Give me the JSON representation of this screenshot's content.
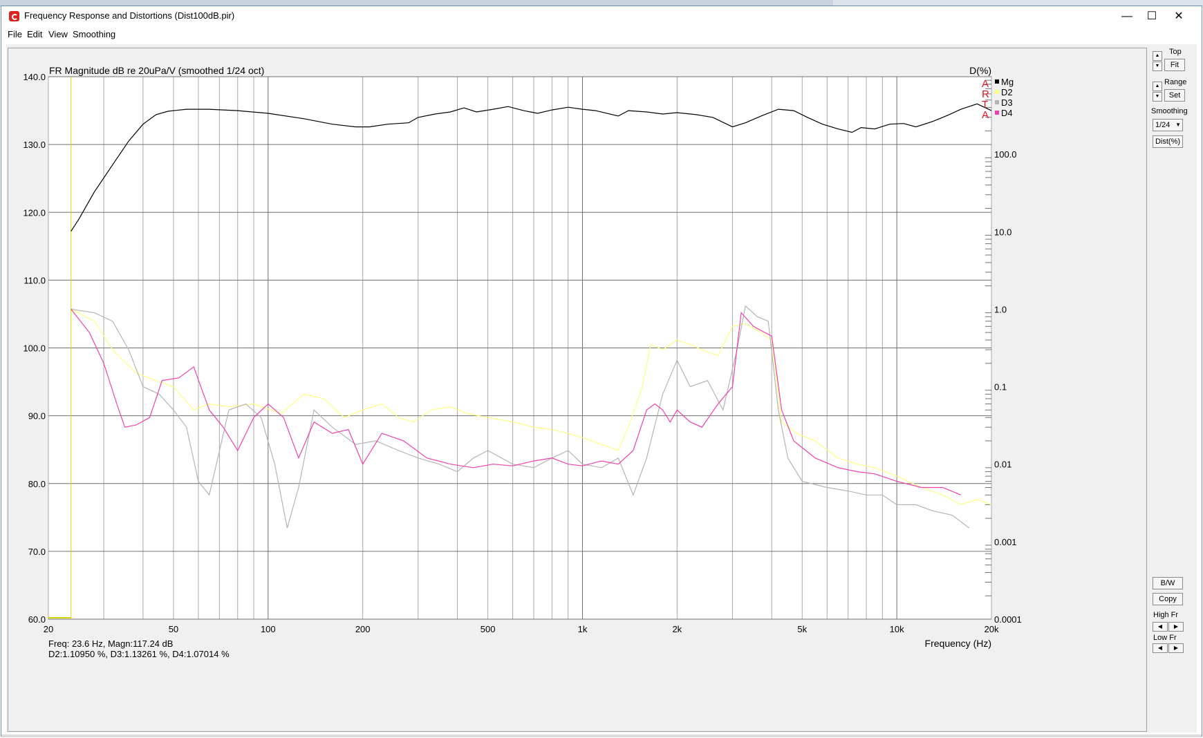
{
  "window": {
    "title": "Frequency Response and Distortions (Dist100dB.pir)",
    "minimize": "—",
    "maximize": "☐",
    "close": "✕"
  },
  "menu": [
    "File",
    "Edit",
    "View",
    "Smoothing"
  ],
  "side": {
    "top_label": "Top",
    "fit_btn": "Fit",
    "range_label": "Range",
    "set_btn": "Set",
    "smoothing_label": "Smoothing",
    "smoothing_value": "1/24",
    "dist_btn": "Dist(%)",
    "bw_btn": "B/W",
    "copy_btn": "Copy",
    "highfr_label": "High Fr",
    "lowfr_label": "Low Fr"
  },
  "status": {
    "line1": "Freq: 23.6 Hz, Magn:117.24 dB",
    "line2": "D2:1.10950 %, D3:1.13261 %, D4:1.07014 %"
  },
  "brand": [
    "A",
    "R",
    "T",
    "A"
  ],
  "chart_data": {
    "type": "line",
    "title": "FR Magnitude dB re 20uPa/V (smoothed 1/24 oct)",
    "xlabel": "Frequency (Hz)",
    "ylabel": "",
    "ylabel_right": "D(%)",
    "xscale": "log",
    "xlim": [
      20,
      20000
    ],
    "ylim": [
      60,
      140
    ],
    "y2scale": "log",
    "y2lim": [
      0.0001,
      1000
    ],
    "grid": true,
    "legend": "top-right",
    "x_ticks": [
      {
        "v": 20,
        "label": "20"
      },
      {
        "v": 50,
        "label": "50"
      },
      {
        "v": 100,
        "label": "100"
      },
      {
        "v": 200,
        "label": "200"
      },
      {
        "v": 500,
        "label": "500"
      },
      {
        "v": 1000,
        "label": "1k"
      },
      {
        "v": 2000,
        "label": "2k"
      },
      {
        "v": 5000,
        "label": "5k"
      },
      {
        "v": 10000,
        "label": "10k"
      },
      {
        "v": 20000,
        "label": "20k"
      }
    ],
    "y_ticks": [
      "60.0",
      "70.0",
      "80.0",
      "90.0",
      "100.0",
      "110.0",
      "120.0",
      "130.0",
      "140.0"
    ],
    "y2_ticks": [
      {
        "v": 0.0001,
        "label": "0.0001"
      },
      {
        "v": 0.001,
        "label": "0.001"
      },
      {
        "v": 0.01,
        "label": "0.01"
      },
      {
        "v": 0.1,
        "label": "0.1"
      },
      {
        "v": 1,
        "label": "1.0"
      },
      {
        "v": 10,
        "label": "10.0"
      },
      {
        "v": 100,
        "label": "100.0"
      }
    ],
    "cursor_x": 23.6,
    "series": [
      {
        "name": "Mg",
        "axis": "left",
        "color": "#000000",
        "x": [
          23.6,
          25,
          28,
          32,
          36,
          40,
          44,
          48,
          55,
          65,
          80,
          100,
          130,
          160,
          190,
          210,
          240,
          280,
          300,
          340,
          380,
          420,
          460,
          520,
          580,
          650,
          720,
          800,
          900,
          1000,
          1100,
          1300,
          1400,
          1600,
          1800,
          2000,
          2300,
          2600,
          3000,
          3300,
          3700,
          4200,
          4700,
          5200,
          5800,
          6500,
          7200,
          7700,
          8500,
          9500,
          10500,
          11500,
          13000,
          14500,
          16000,
          18000,
          20000
        ],
        "y": [
          117.2,
          119,
          123,
          127,
          130.5,
          133,
          134.4,
          134.9,
          135.2,
          135.2,
          135,
          134.6,
          133.8,
          133,
          132.6,
          132.6,
          133,
          133.2,
          134,
          134.5,
          134.8,
          135.4,
          134.8,
          135.2,
          135.6,
          135,
          134.6,
          135.1,
          135.5,
          135.2,
          135,
          134.2,
          135,
          134.8,
          134.5,
          134.7,
          134.4,
          134.0,
          132.6,
          133.2,
          134.2,
          135.2,
          135.0,
          134.0,
          133.0,
          132.3,
          131.8,
          132.5,
          132.3,
          133.0,
          133.1,
          132.6,
          133.4,
          134.3,
          135.2,
          136.0,
          135.0
        ]
      },
      {
        "name": "D2",
        "axis": "right",
        "color": "#ffff80",
        "x": [
          23.6,
          28,
          32,
          38,
          44,
          50,
          58,
          65,
          75,
          90,
          110,
          130,
          150,
          175,
          200,
          230,
          260,
          290,
          330,
          380,
          430,
          500,
          600,
          700,
          800,
          900,
          1000,
          1150,
          1300,
          1400,
          1550,
          1650,
          1800,
          2000,
          2200,
          2400,
          2700,
          3000,
          3300,
          3700,
          4000,
          4300,
          4800,
          5500,
          6500,
          7500,
          8500,
          10000,
          12000,
          14000,
          16000,
          18000,
          20000
        ],
        "y": [
          1.0,
          0.7,
          0.3,
          0.15,
          0.12,
          0.1,
          0.05,
          0.06,
          0.055,
          0.06,
          0.045,
          0.08,
          0.07,
          0.04,
          0.05,
          0.06,
          0.04,
          0.035,
          0.05,
          0.055,
          0.045,
          0.04,
          0.035,
          0.03,
          0.028,
          0.025,
          0.022,
          0.018,
          0.015,
          0.03,
          0.1,
          0.35,
          0.3,
          0.4,
          0.35,
          0.3,
          0.25,
          0.6,
          0.65,
          0.5,
          0.4,
          0.035,
          0.025,
          0.02,
          0.012,
          0.01,
          0.009,
          0.007,
          0.005,
          0.004,
          0.003,
          0.0035,
          0.003
        ]
      },
      {
        "name": "D3",
        "axis": "right",
        "color": "#b4b4b4",
        "x": [
          23.6,
          28,
          32,
          36,
          40,
          45,
          50,
          55,
          60,
          65,
          75,
          85,
          95,
          105,
          115,
          125,
          140,
          160,
          190,
          220,
          260,
          300,
          350,
          400,
          450,
          500,
          600,
          700,
          800,
          900,
          1000,
          1150,
          1300,
          1450,
          1600,
          1800,
          2000,
          2200,
          2500,
          2800,
          3100,
          3300,
          3600,
          3900,
          4200,
          4500,
          5000,
          6000,
          7000,
          8000,
          9000,
          10000,
          11500,
          13000,
          15000,
          17000
        ],
        "y": [
          1.0,
          0.9,
          0.7,
          0.3,
          0.1,
          0.08,
          0.05,
          0.03,
          0.006,
          0.004,
          0.05,
          0.06,
          0.04,
          0.01,
          0.0015,
          0.005,
          0.05,
          0.03,
          0.018,
          0.02,
          0.015,
          0.012,
          0.01,
          0.008,
          0.012,
          0.015,
          0.01,
          0.009,
          0.012,
          0.015,
          0.01,
          0.009,
          0.012,
          0.004,
          0.012,
          0.08,
          0.22,
          0.1,
          0.12,
          0.05,
          0.3,
          1.1,
          0.8,
          0.7,
          0.05,
          0.012,
          0.006,
          0.005,
          0.0045,
          0.004,
          0.004,
          0.003,
          0.003,
          0.0025,
          0.0022,
          0.0015
        ]
      },
      {
        "name": "D4",
        "axis": "right",
        "color": "#f040b0",
        "x": [
          23.6,
          27,
          30,
          33,
          35,
          38,
          42,
          46,
          52,
          58,
          65,
          72,
          80,
          90,
          100,
          112,
          125,
          140,
          160,
          180,
          200,
          230,
          270,
          320,
          380,
          450,
          520,
          600,
          700,
          800,
          900,
          1000,
          1150,
          1300,
          1450,
          1600,
          1700,
          1800,
          1900,
          2000,
          2200,
          2400,
          2700,
          3000,
          3200,
          3500,
          3800,
          4000,
          4300,
          4700,
          5500,
          6500,
          7500,
          8500,
          10000,
          12000,
          14000,
          16000
        ],
        "y": [
          1.0,
          0.5,
          0.2,
          0.06,
          0.03,
          0.032,
          0.04,
          0.12,
          0.13,
          0.18,
          0.05,
          0.03,
          0.015,
          0.04,
          0.06,
          0.04,
          0.012,
          0.035,
          0.025,
          0.028,
          0.01,
          0.025,
          0.02,
          0.012,
          0.01,
          0.009,
          0.01,
          0.0095,
          0.011,
          0.012,
          0.01,
          0.0095,
          0.011,
          0.01,
          0.015,
          0.05,
          0.06,
          0.05,
          0.035,
          0.05,
          0.035,
          0.03,
          0.06,
          0.1,
          0.9,
          0.6,
          0.5,
          0.45,
          0.05,
          0.02,
          0.012,
          0.009,
          0.008,
          0.0075,
          0.006,
          0.005,
          0.005,
          0.004
        ]
      }
    ]
  }
}
